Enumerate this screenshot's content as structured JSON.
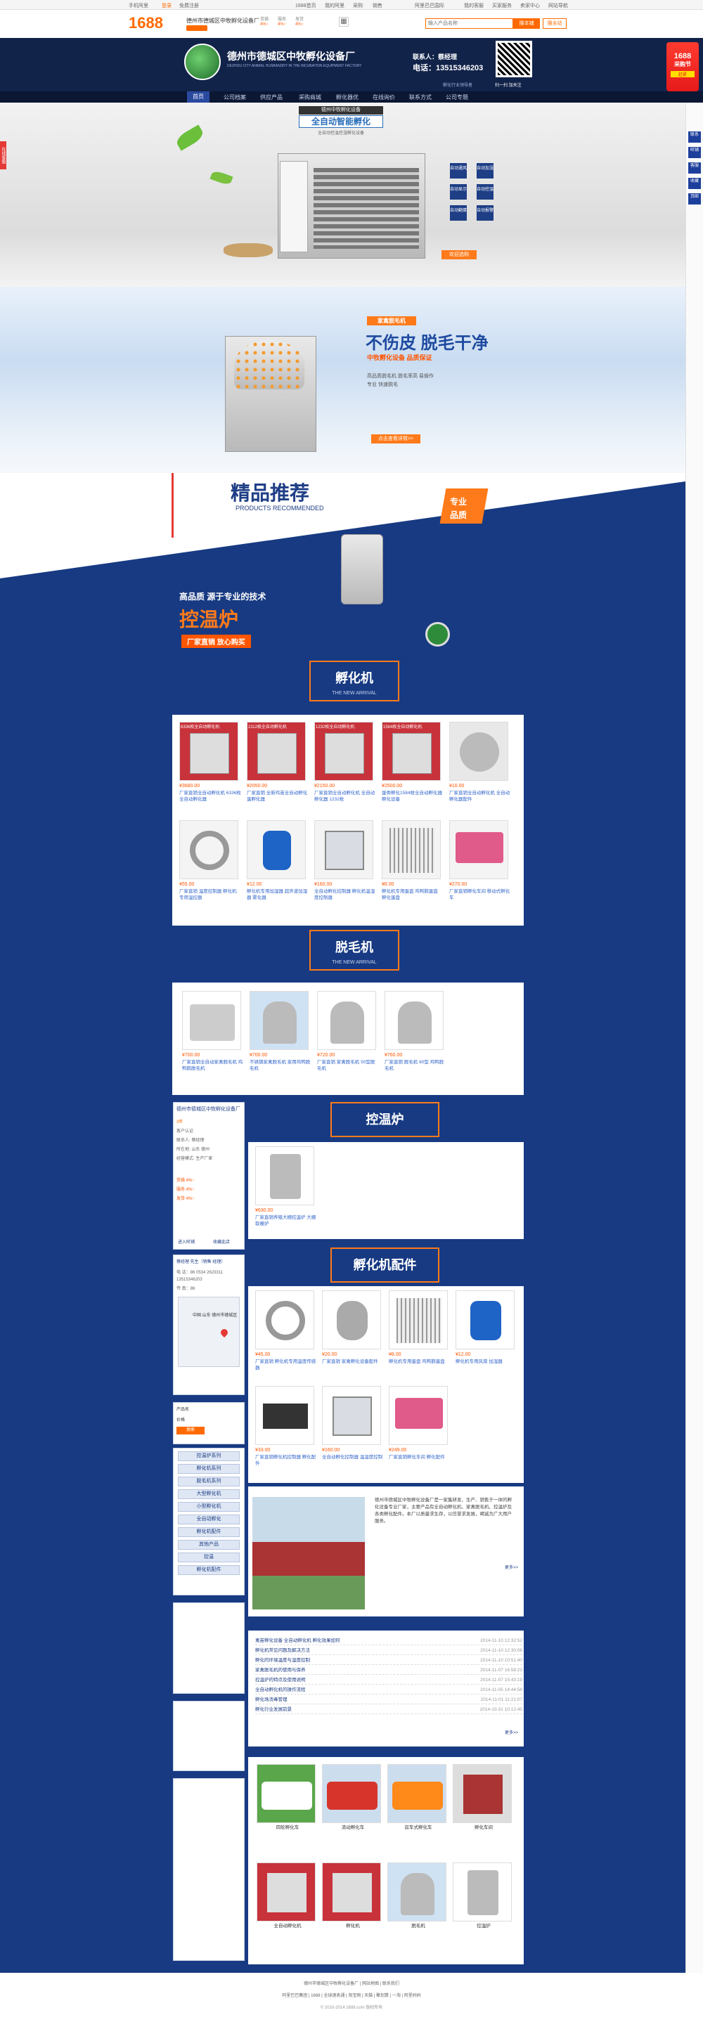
{
  "topbar": {
    "phone_link": "手机阿里",
    "items": [
      "1688首页",
      "我的阿里",
      "采购",
      "销售",
      "阿里巴巴国际",
      "我的客服",
      "买家服务",
      "卖家中心",
      "网站导航"
    ],
    "login": "登录",
    "register": "免费注册"
  },
  "header": {
    "logo": "1688",
    "shop_name": "德州市德城区中牧孵化设备厂",
    "search_placeholder": "输入产品名称",
    "search_btn": "搜本铺",
    "search_all": "搜全站",
    "rating_labels": [
      "货描",
      "服务",
      "发货"
    ],
    "rating_values": [
      "4%↑",
      "4%↑",
      "4%↑"
    ]
  },
  "brand": {
    "cn": "德州市德城区中牧孵化设备厂",
    "en": "DEZHOU CITY ANIMAL HUSBANDRY IN THE INCUBATION EQUIPMENT FACTORY",
    "contact_label": "联系人：",
    "contact": "蔡经理",
    "phone_label": "电话：",
    "phone": "13515346203",
    "qr_caption": "扫一扫 加关注",
    "slogan": "孵化行业领导者"
  },
  "nav": {
    "items": [
      "首页",
      "公司档案",
      "供应产品",
      "采购商城",
      "孵化器优",
      "在线询价",
      "联系方式",
      "公司专题"
    ]
  },
  "hero1": {
    "top_label": "德州中牧孵化设备",
    "title": "全自动智能孵化",
    "sub": "全自动控温控湿孵化设备",
    "buttons": [
      "自动通风",
      "自动加湿",
      "自动显示",
      "自动控温",
      "自动翻蛋",
      "自动报警"
    ],
    "cta": "欢迎选购"
  },
  "hero2": {
    "badge": "家禽脱毛机",
    "title": "不伤皮 脱毛干净",
    "sub": "中牧孵化设备 品质保证",
    "desc1": "高品质脱毛机 脱毛率高 易操作",
    "desc2": "专业 快速脱毛",
    "cta": "点击查看详情>>"
  },
  "recommend": {
    "title": "精品推荐",
    "en": "PRODUCTS RECOMMENDED",
    "badge1": "专业",
    "badge2": "品质",
    "tag": "高品质 源于专业的技术",
    "product": "控温炉",
    "sub": "厂家直销 放心购买"
  },
  "sections": [
    {
      "title": "孵化机",
      "sub": "THE NEW ARRIVAL"
    },
    {
      "title": "脱毛机",
      "sub": "THE NEW ARRIVAL"
    },
    {
      "title": "控温炉",
      "sub": ""
    },
    {
      "title": "孵化机配件",
      "sub": ""
    }
  ],
  "hatch": [
    {
      "tag": "6336枚全自动孵化机",
      "price": "¥3680.00",
      "name": "厂家直销全自动孵化机 6336枚全自动孵化器"
    },
    {
      "tag": "2112枚全自动孵化机",
      "price": "¥2050.00",
      "name": "厂家直销 全新鸡苗全自动孵化 蛋孵化器"
    },
    {
      "tag": "1232枚全自动孵化机",
      "price": "¥2150.00",
      "name": "厂家直销全自动孵化机 全自动孵化器 1232枚"
    },
    {
      "tag": "1584枚全自动孵化机",
      "price": "¥2500.00",
      "name": "蛋类孵化1584枚全自动孵化器 孵化设备"
    },
    {
      "tag": "",
      "price": "¥10.00",
      "name": "厂家直销全自动孵化机 全自动孵化器配件"
    },
    {
      "tag": "",
      "price": "¥55.00",
      "name": "厂家直销 温度控制器 孵化机专用温控器"
    },
    {
      "tag": "",
      "price": "¥12.00",
      "name": "孵化机专用加湿器 超声波加湿器 雾化器"
    },
    {
      "tag": "",
      "price": "¥160.00",
      "name": "全自动孵化控制器 孵化机温湿度控制器"
    },
    {
      "tag": "",
      "price": "¥8.00",
      "name": "孵化机专用蛋盘 鸡鸭鹅蛋盘 孵化蛋盘"
    },
    {
      "tag": "",
      "price": "¥270.00",
      "name": "厂家直销孵化车间 移动式孵化车"
    }
  ],
  "pluck": [
    {
      "price": "¥700.00",
      "name": "厂家直销全自动家禽脱毛机 鸡鸭鹅脱毛机"
    },
    {
      "price": "¥700.00",
      "name": "不锈钢家禽脱毛机 家用鸡鸭脱毛机"
    },
    {
      "price": "¥720.00",
      "name": "厂家直销 家禽脱毛机 50型脱毛机"
    },
    {
      "price": "¥760.00",
      "name": "厂家直销 脱毛机 60型 鸡鸭脱毛机"
    }
  ],
  "heater": [
    {
      "price": "¥630.00",
      "name": "厂家直销养殖大棚控温炉 大棚取暖炉"
    }
  ],
  "parts": [
    {
      "price": "¥45.00",
      "name": "厂家直销 孵化机专用温度传感器"
    },
    {
      "price": "¥20.00",
      "name": "厂家直销 家禽孵化设备配件"
    },
    {
      "price": "¥8.00",
      "name": "孵化机专用蛋盘 鸡鸭鹅蛋盘"
    },
    {
      "price": "¥12.00",
      "name": "孵化机专用风扇 加湿器"
    },
    {
      "price": "¥33.00",
      "name": "厂家直销孵化机控制器 孵化配件"
    },
    {
      "price": "¥160.00",
      "name": "全自动孵化控制器 温湿度控制"
    },
    {
      "price": "¥249.00",
      "name": "厂家直销孵化车间 孵化配件"
    }
  ],
  "company_card": {
    "name": "德州市德城区中牧孵化设备厂",
    "years": "3年",
    "rows": [
      "客户认证",
      "联系人: 蔡经理",
      "所在地: 山东 德州",
      "经营模式: 生产厂家"
    ],
    "ratings": [
      "货描 4%↑",
      "服务 4%↑",
      "发货 4%↑"
    ],
    "btn1": "进入旺铺",
    "btn2": "收藏此店"
  },
  "contact_card": {
    "name": "蔡经理 先生（销售 经理）",
    "tel": "电 话：86 0534 2623311",
    "mobile": "13515346203",
    "fax": "传 真：86",
    "addr": "中国 山东 德州市德城区"
  },
  "search_card": {
    "title": "产品名",
    "price_label": "价格",
    "btn": "搜索"
  },
  "categories": [
    "控温炉系列",
    "孵化机系列",
    "脱毛机系列",
    "大型孵化机",
    "小型孵化机",
    "全自动孵化",
    "孵化机配件",
    "其他产品",
    "控温",
    "孵化机配件"
  ],
  "company": {
    "intro": "德州市德城区中牧孵化设备厂是一家集研发、生产、销售于一体的孵化设备专业厂家，主要产品有全自动孵化机、家禽脱毛机、控温炉及各类孵化配件。本厂以质量求生存，以信誉求发展，竭诚为广大用户服务。",
    "more": "更多>>"
  },
  "news": [
    {
      "t": "禽苗孵化设备 全自动孵化机 孵化效果如何",
      "d": "2014-11-10 12:32:52"
    },
    {
      "t": "孵化机常见问题及解决方法",
      "d": "2014-11-10 12:30:08"
    },
    {
      "t": "孵化的环境温度与湿度控制",
      "d": "2014-11-10 10:51:40"
    },
    {
      "t": "家禽脱毛机的使用与保养",
      "d": "2014-11-07 16:58:23"
    },
    {
      "t": "控温炉的特点及使用说明",
      "d": "2014-11-07 15:43:19"
    },
    {
      "t": "全自动孵化机的操作流程",
      "d": "2014-11-05 14:44:58"
    },
    {
      "t": "孵化场消毒管理",
      "d": "2014-11-01 11:21:07"
    },
    {
      "t": "孵化行业发展前景",
      "d": "2014-10-31 10:12:45"
    }
  ],
  "gallery": [
    {
      "n": "四轮孵化车"
    },
    {
      "n": "流动孵化车"
    },
    {
      "n": "房车式孵化车"
    },
    {
      "n": "孵化车间"
    },
    {
      "n": "全自动孵化机"
    },
    {
      "n": "孵化机"
    },
    {
      "n": "脱毛机"
    },
    {
      "n": "控温炉"
    }
  ],
  "footer": {
    "l1": "德州市德城区中牧孵化设备厂 | 网站地图 | 联系我们",
    "l2": "阿里巴巴集团 | 1688 | 全球速卖通 | 淘宝网 | 天猫 | 聚划算 | 一淘 | 阿里妈妈",
    "l3": "© 2010-2014 1688.com 版权所有"
  },
  "rightbar": {
    "items": [
      "联系",
      "旺铺",
      "客服",
      "收藏",
      "顶部"
    ]
  },
  "promo": {
    "t1": "1688",
    "t2": "采购节",
    "t3": "赶紧"
  }
}
